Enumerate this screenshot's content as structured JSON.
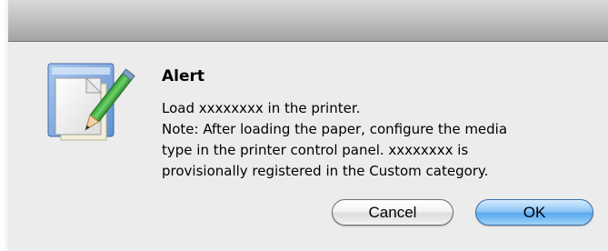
{
  "dialog": {
    "title": "Alert",
    "message_lines": [
      "Load xxxxxxxx in the printer.",
      "Note: After loading the paper, configure the media",
      "type in the printer control panel. xxxxxxxx is",
      "provisionally registered in the Custom category."
    ],
    "icon": "document-with-pencil-icon"
  },
  "buttons": {
    "cancel_label": "Cancel",
    "ok_label": "OK"
  },
  "colors": {
    "dialog_background": "#ececec",
    "default_button": "#5aa8ee"
  }
}
